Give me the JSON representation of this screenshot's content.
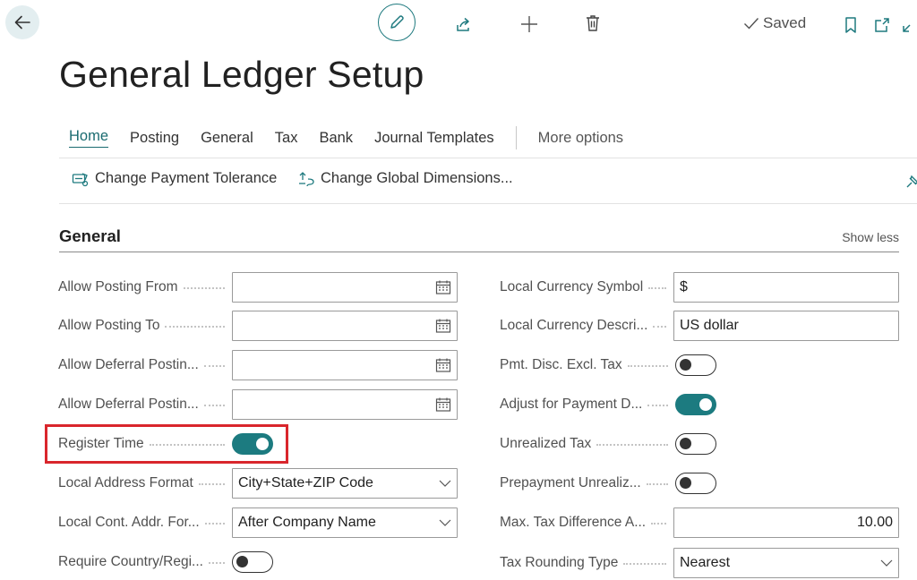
{
  "toolbar": {
    "saved_label": "Saved"
  },
  "page": {
    "title": "General Ledger Setup"
  },
  "tabs": [
    {
      "label": "Home"
    },
    {
      "label": "Posting"
    },
    {
      "label": "General"
    },
    {
      "label": "Tax"
    },
    {
      "label": "Bank"
    },
    {
      "label": "Journal Templates"
    },
    {
      "label": "More options"
    }
  ],
  "actions": [
    {
      "label": "Change Payment Tolerance",
      "icon": "payment-tolerance-icon"
    },
    {
      "label": "Change Global Dimensions...",
      "icon": "global-dimensions-icon"
    }
  ],
  "section": {
    "title": "General",
    "toggle_label": "Show less"
  },
  "left_fields": [
    {
      "label": "Allow Posting From",
      "type": "date",
      "value": ""
    },
    {
      "label": "Allow Posting To",
      "type": "date",
      "value": ""
    },
    {
      "label": "Allow Deferral Postin...",
      "type": "date",
      "value": ""
    },
    {
      "label": "Allow Deferral Postin...",
      "type": "date",
      "value": ""
    },
    {
      "label": "Register Time",
      "type": "toggle",
      "value": true
    },
    {
      "label": "Local Address Format",
      "type": "select",
      "value": "City+State+ZIP Code"
    },
    {
      "label": "Local Cont. Addr. For...",
      "type": "select",
      "value": "After Company Name"
    },
    {
      "label": "Require Country/Regi...",
      "type": "toggle",
      "value": false
    }
  ],
  "right_fields": [
    {
      "label": "Local Currency Symbol",
      "type": "text",
      "value": "$"
    },
    {
      "label": "Local Currency Descri...",
      "type": "text",
      "value": "US dollar"
    },
    {
      "label": "Pmt. Disc. Excl. Tax",
      "type": "toggle",
      "value": false
    },
    {
      "label": "Adjust for Payment D...",
      "type": "toggle",
      "value": true
    },
    {
      "label": "Unrealized Tax",
      "type": "toggle",
      "value": false
    },
    {
      "label": "Prepayment Unrealiz...",
      "type": "toggle",
      "value": false
    },
    {
      "label": "Max. Tax Difference A...",
      "type": "number",
      "value": "10.00"
    },
    {
      "label": "Tax Rounding Type",
      "type": "select",
      "value": "Nearest"
    }
  ],
  "colors": {
    "accent": "#1c7b80",
    "highlight": "#d9262c"
  }
}
